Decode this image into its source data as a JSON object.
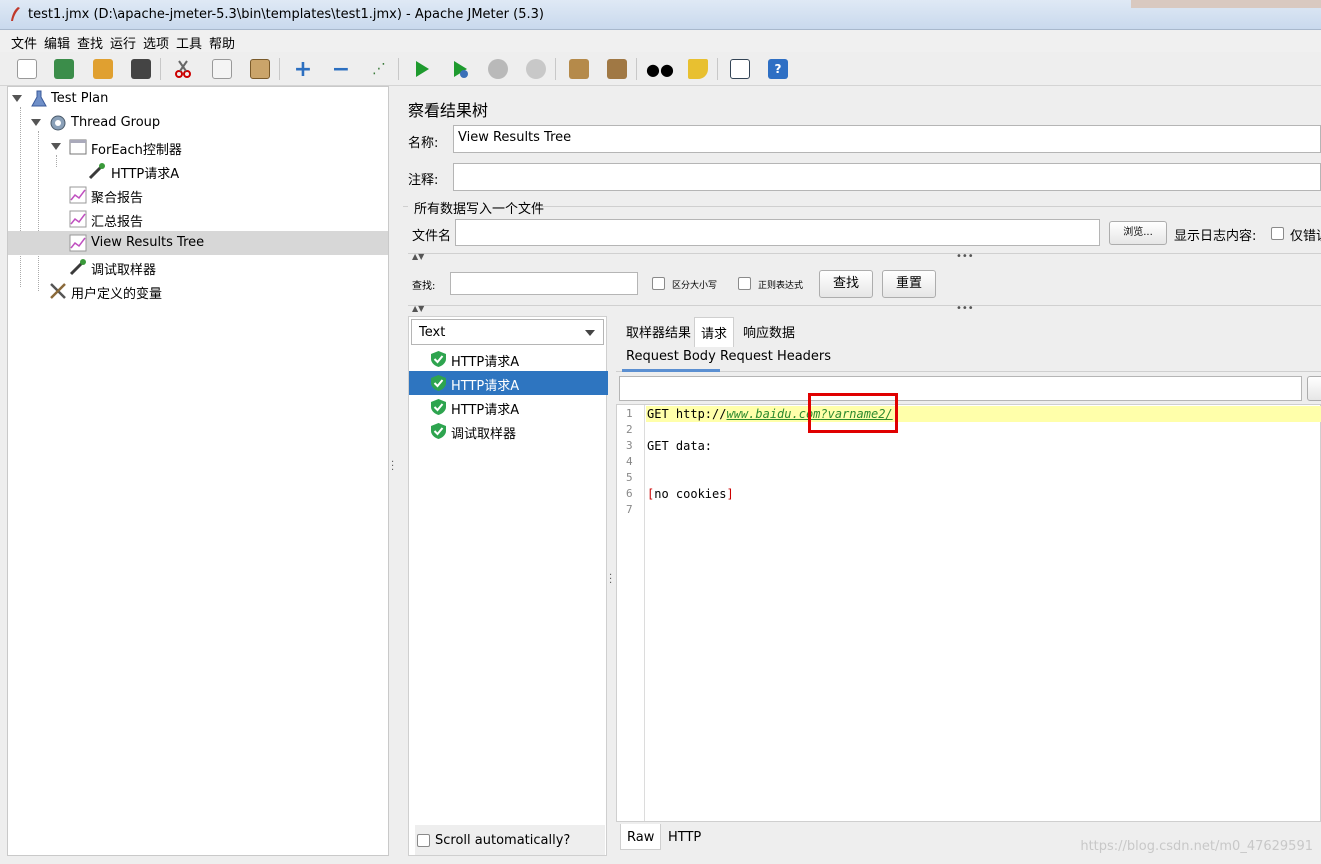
{
  "window": {
    "title": "test1.jmx (D:\\apache-jmeter-5.3\\bin\\templates\\test1.jmx) - Apache JMeter (5.3)"
  },
  "menu": [
    "文件",
    "编辑",
    "查找",
    "运行",
    "选项",
    "工具",
    "帮助"
  ],
  "toolbar": {
    "icons": [
      "new-icon",
      "templates-icon",
      "open-icon",
      "save-icon",
      "cut-icon",
      "copy-icon",
      "paste-icon",
      "expand-icon",
      "collapse-icon",
      "toggle-icon",
      "start-icon",
      "start-no-pause-icon",
      "stop-icon",
      "shutdown-icon",
      "clear-icon",
      "clear-all-icon",
      "search-icon",
      "reset-search-icon",
      "function-helper-icon",
      "help-icon"
    ]
  },
  "tree": {
    "items": [
      {
        "label": "Test Plan",
        "icon": "test-plan-icon"
      },
      {
        "label": "Thread Group",
        "icon": "gear-icon"
      },
      {
        "label": "ForEach控制器",
        "icon": "controller-icon"
      },
      {
        "label": "HTTP请求A",
        "icon": "sampler-icon"
      },
      {
        "label": "聚合报告",
        "icon": "graph-icon"
      },
      {
        "label": "汇总报告",
        "icon": "graph-icon"
      },
      {
        "label": "View Results Tree",
        "icon": "graph-icon"
      },
      {
        "label": "调试取样器",
        "icon": "sampler-icon"
      },
      {
        "label": "用户定义的变量",
        "icon": "tools-icon"
      }
    ]
  },
  "panel": {
    "title": "察看结果树",
    "name_label": "名称:",
    "name_value": "View Results Tree",
    "comment_label": "注释:",
    "comment_value": "",
    "file_group_title": "所有数据写入一个文件",
    "filename_label": "文件名",
    "filename_value": "",
    "browse_button": "浏览...",
    "log_label": "显示日志内容:",
    "errors_only_label": "仅错误",
    "search_label": "查找:",
    "search_value": "",
    "case_sensitive_label": "区分大小写",
    "regex_label": "正则表达式",
    "find_button": "查找",
    "reset_button": "重置"
  },
  "results": {
    "renderer": "Text",
    "items": [
      "HTTP请求A",
      "HTTP请求A",
      "HTTP请求A",
      "调试取样器"
    ],
    "selected_index": 1,
    "scroll_auto_label": "Scroll automatically?"
  },
  "detail": {
    "tabs": [
      "取样器结果",
      "请求",
      "响应数据"
    ],
    "active_tab": "请求",
    "subtabs": [
      "Request Body",
      "Request Headers"
    ],
    "active_subtab": "Request Body",
    "search_value": "",
    "line_numbers": [
      "1",
      "2",
      "3",
      "4",
      "5",
      "6",
      "7"
    ],
    "line1_prefix": "GET http://",
    "line1_host": "www.baidu.com",
    "line1_query": "?varname2/",
    "line3": "GET data:",
    "line6_open": "[",
    "line6_text": "no cookies",
    "line6_close": "]",
    "bottom_tabs": [
      "Raw",
      "HTTP"
    ],
    "active_bottom_tab": "Raw"
  },
  "watermark": "https://blog.csdn.net/m0_47629591",
  "colors": {
    "selection": "#2e75c0",
    "highlight_line": "#ffffaa",
    "url_green": "#2d8a2d",
    "annotation_red": "#e00000"
  }
}
